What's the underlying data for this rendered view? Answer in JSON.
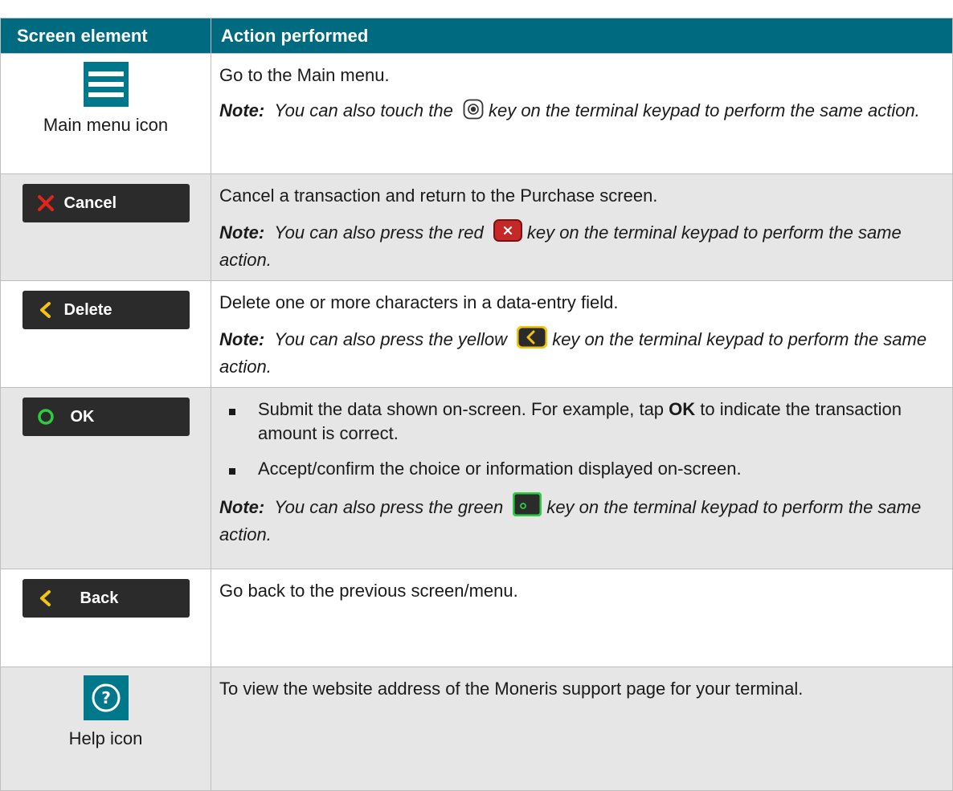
{
  "header": {
    "col1": "Screen element",
    "col2": "Action performed"
  },
  "rows": [
    {
      "caption": "Main menu icon",
      "action": "Go to the Main menu.",
      "note_label": "Note:",
      "note_a": "You can also touch the",
      "note_b": "key on the terminal keypad to perform the same action."
    },
    {
      "button": "Cancel",
      "action": "Cancel a transaction and return to the Purchase screen.",
      "note_label": "Note:",
      "note_a": "You can also press the red",
      "note_b": "key on the terminal keypad to perform the same action."
    },
    {
      "button": "Delete",
      "action": "Delete one or more characters in a data-entry field.",
      "note_label": "Note:",
      "note_a": "You can also press the yellow",
      "note_b": "key on the terminal keypad to perform the same action."
    },
    {
      "button": "OK",
      "bullet1_a": "Submit the data shown on-screen. For example, tap",
      "bullet1_bold": "OK",
      "bullet1_b": "to indicate the transaction amount is correct.",
      "bullet2": "Accept/confirm the choice or information displayed on-screen.",
      "note_label": "Note:",
      "note_a": "You can also press the green",
      "note_b": "key on the terminal keypad to perform the same action."
    },
    {
      "button": "Back",
      "action": "Go back to the previous screen/menu."
    },
    {
      "caption": "Help icon",
      "action": "To view the website address of the Moneris support page for your terminal."
    }
  ],
  "colors": {
    "header_bg": "#006b80",
    "shade": "#e6e6e6",
    "icon_teal": "#00788c"
  },
  "icons": [
    "hamburger-menu-icon",
    "x-icon",
    "chevron-left-icon",
    "circle-icon",
    "question-circle-icon",
    "keypad-key-icon"
  ]
}
